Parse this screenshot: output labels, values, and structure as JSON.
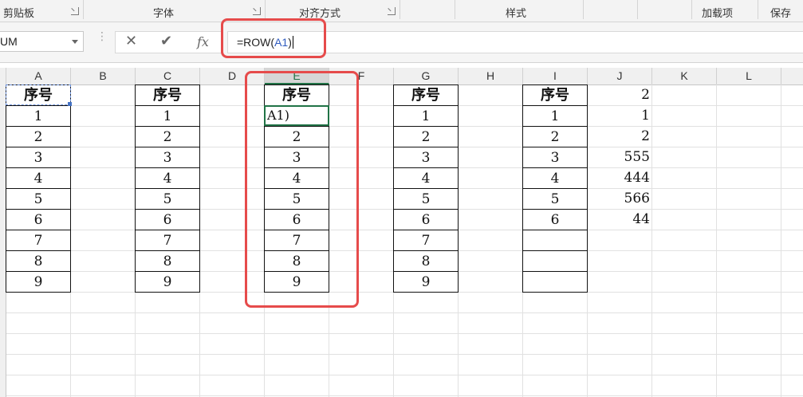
{
  "ribbon": {
    "groups": [
      "剪贴板",
      "字体",
      "对齐方式",
      "样式",
      "加载项",
      "保存"
    ]
  },
  "formula_bar": {
    "name_box": "UM",
    "cancel_icon": "✕",
    "enter_icon": "✔",
    "fx_label": "fx",
    "formula_prefix": "=ROW(",
    "formula_ref": "A1",
    "formula_suffix": ")"
  },
  "columns": [
    "A",
    "B",
    "C",
    "D",
    "E",
    "F",
    "G",
    "H",
    "I",
    "J",
    "K",
    "L"
  ],
  "sheet": {
    "header": "序号",
    "seq": [
      "1",
      "2",
      "3",
      "4",
      "5",
      "6",
      "7",
      "8",
      "9"
    ],
    "e_editing": "A1)",
    "e_values": [
      "2",
      "3",
      "4",
      "5",
      "6",
      "7",
      "8",
      "9"
    ],
    "i_values": [
      "1",
      "2",
      "3",
      "4",
      "5",
      "6"
    ],
    "j_values": [
      "2",
      "1",
      "2",
      "555",
      "444",
      "566",
      "44"
    ]
  },
  "annotation_color": "#e64b4b",
  "selection_color": "#217346"
}
